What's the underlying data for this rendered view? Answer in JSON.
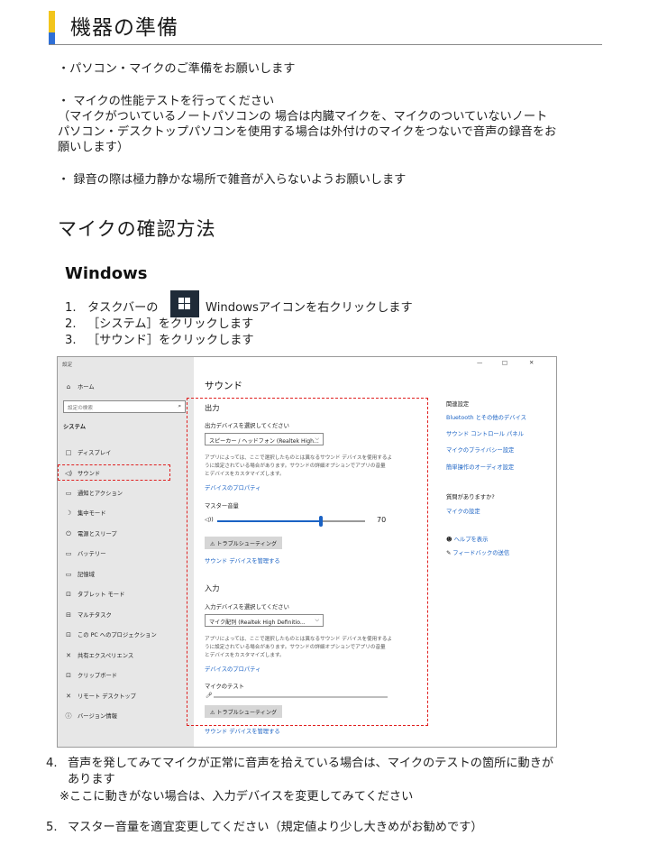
{
  "header": {
    "title": "機器の準備"
  },
  "intro": {
    "line1": "・パソコン・マイクのご準備をお願いします",
    "line2": "・ マイクの性能テストを行ってください",
    "line3": "（マイクがついているノートパソコンの 場合は内臓マイクを、マイクのついていないノート",
    "line4": "パソコン・デスクトップパソコンを使用する場合は外付けのマイクをつないで音声の録音をお",
    "line5": "願いします）",
    "line6": "・ 録音の際は極力静かな場所で雑音が入らないようお願いします"
  },
  "section": {
    "title": "マイクの確認方法",
    "subtitle": "Windows"
  },
  "steps": {
    "s1_num": "1.",
    "s1_pre": "タスクバーの",
    "s1_post": "Windowsアイコンを右クリックします",
    "s2_num": "2.",
    "s2": "［システム］をクリックします",
    "s3_num": "3.",
    "s3": "［サウンド］をクリックします",
    "s4_num": "4.",
    "s4a": "音声を発してみてマイクが正常に音声を拾えている場合は、マイクのテストの箇所に動きが",
    "s4b": "あります",
    "s4c": "※ここに動きがない場合は、入力デバイスを変更してみてください",
    "s5_num": "5.",
    "s5": "マスター音量を適宜変更してください（規定値より少し大きめがお勧めです）"
  },
  "settings": {
    "window_title": "設定",
    "minimize": "—",
    "maximize": "□",
    "close": "✕",
    "home": "ホーム",
    "search_placeholder": "設定の検索",
    "system": "システム",
    "nav": [
      {
        "icon": "□",
        "label": "ディスプレイ"
      },
      {
        "icon": "◁)",
        "label": "サウンド"
      },
      {
        "icon": "▭",
        "label": "通知とアクション"
      },
      {
        "icon": "☽",
        "label": "集中モード"
      },
      {
        "icon": "⏻",
        "label": "電源とスリープ"
      },
      {
        "icon": "▭",
        "label": "バッテリー"
      },
      {
        "icon": "▭",
        "label": "記憶域"
      },
      {
        "icon": "⊡",
        "label": "タブレット モード"
      },
      {
        "icon": "⊟",
        "label": "マルチタスク"
      },
      {
        "icon": "⊡",
        "label": "この PC へのプロジェクション"
      },
      {
        "icon": "✕",
        "label": "共有エクスペリエンス"
      },
      {
        "icon": "⊡",
        "label": "クリップボード"
      },
      {
        "icon": "✕",
        "label": "リモート デスクトップ"
      },
      {
        "icon": "ⓘ",
        "label": "バージョン情報"
      }
    ],
    "page_title": "サウンド",
    "output": {
      "heading": "出力",
      "select_label": "出力デバイスを選択してください",
      "device": "スピーカー / ヘッドフォン (Realtek High...",
      "desc1": "アプリによっては、ここで選択したものとは異なるサウンド デバイスを使用するよ",
      "desc2": "うに設定されている場合があります。サウンドの詳細オプションでアプリの音量",
      "desc3": "とデバイスをカスタマイズします。",
      "properties": "デバイスのプロパティ",
      "volume_label": "マスター音量",
      "volume_value": "70",
      "volume": 70,
      "troubleshoot": "トラブルシューティング",
      "manage": "サウンド デバイスを管理する"
    },
    "input": {
      "heading": "入力",
      "select_label": "入力デバイスを選択してください",
      "device": "マイク配列 (Realtek High Definitio...",
      "desc1": "アプリによっては、ここで選択したものとは異なるサウンド デバイスを使用するよ",
      "desc2": "うに設定されている場合があります。サウンドの詳細オプションでアプリの音量",
      "desc3": "とデバイスをカスタマイズします。",
      "properties": "デバイスのプロパティ",
      "mic_test": "マイクのテスト",
      "mic_level": 0,
      "troubleshoot": "トラブルシューティング",
      "manage": "サウンド デバイスを管理する"
    },
    "related": {
      "heading": "関連設定",
      "links": [
        "Bluetooth とその他のデバイス",
        "サウンド コントロール パネル",
        "マイクのプライバシー設定",
        "簡単操作のオーディオ設定"
      ]
    },
    "questions": {
      "heading": "質問がありますか?",
      "link": "マイクの設定"
    },
    "help": {
      "show_help": "ヘルプを表示",
      "feedback": "フィードバックの送信"
    }
  },
  "colors": {
    "accent_yellow": "#f2c51c",
    "accent_blue": "#2f6fd6",
    "link": "#1a62c4",
    "highlight": "#e02020"
  }
}
